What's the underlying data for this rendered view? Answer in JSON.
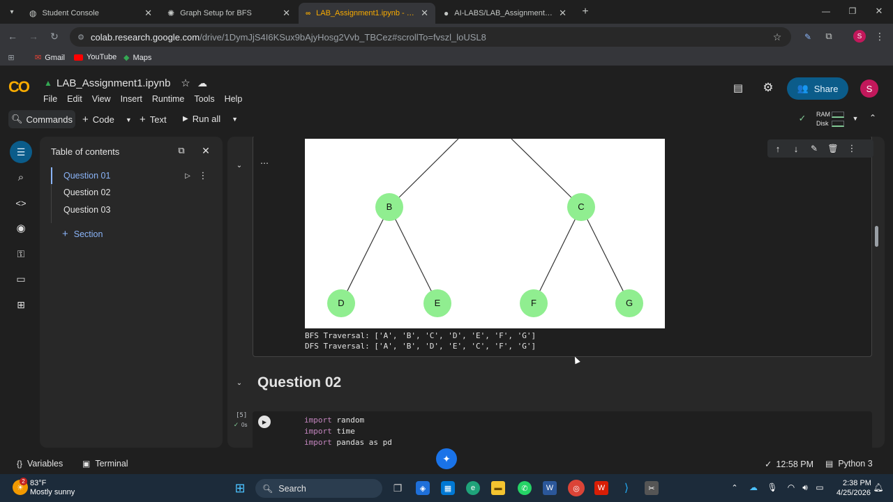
{
  "browser": {
    "tabs": [
      {
        "title": "Student Console",
        "active": false
      },
      {
        "title": "Graph Setup for BFS",
        "active": false
      },
      {
        "title": "LAB_Assignment1.ipynb - Colab",
        "active": true
      },
      {
        "title": "AI-LABS/LAB_Assignment1.ipynb",
        "active": false
      }
    ],
    "url_host": "colab.research.google.com",
    "url_path": "/drive/1DymJjS4I6KSux9bAjyHosg2Vvb_TBCez#scrollTo=fvszl_loUSL8",
    "bookmarks": [
      "Gmail",
      "YouTube",
      "Maps"
    ],
    "profile_initial": "S"
  },
  "colab": {
    "logo_text": "CO",
    "notebook_title": "LAB_Assignment1.ipynb",
    "menu": [
      "File",
      "Edit",
      "View",
      "Insert",
      "Runtime",
      "Tools",
      "Help"
    ],
    "share_label": "Share",
    "user_initial": "S",
    "toolbar": {
      "commands": "Commands",
      "code": "Code",
      "text": "Text",
      "run_all": "Run all",
      "ram": "RAM",
      "disk": "Disk"
    }
  },
  "toc": {
    "title": "Table of contents",
    "items": [
      "Question 01",
      "Question 02",
      "Question 03"
    ],
    "section_label": "Section"
  },
  "output": {
    "bfs": "BFS Traversal: ['A', 'B', 'C', 'D', 'E', 'F', 'G']",
    "dfs": "DFS Traversal: ['A', 'B', 'D', 'E', 'C', 'F', 'G']"
  },
  "graph": {
    "nodes": [
      "B",
      "C",
      "D",
      "E",
      "F",
      "G"
    ],
    "node_color": "#90ee90"
  },
  "question_02": {
    "heading": "Question 02",
    "exec_count": "[5]",
    "exec_time": "0s",
    "code_lines": [
      {
        "kw": "import",
        "rest": " random"
      },
      {
        "kw": "import",
        "rest": " time"
      },
      {
        "kw": "import",
        "rest": " pandas as pd"
      }
    ]
  },
  "status": {
    "variables": "Variables",
    "terminal": "Terminal",
    "time": "12:58 PM",
    "runtime": "Python 3"
  },
  "taskbar": {
    "temp": "83°F",
    "weather": "Mostly sunny",
    "weather_badge": "2",
    "search": "Search",
    "clock_time": "2:38 PM",
    "clock_date": "4/25/2026"
  }
}
